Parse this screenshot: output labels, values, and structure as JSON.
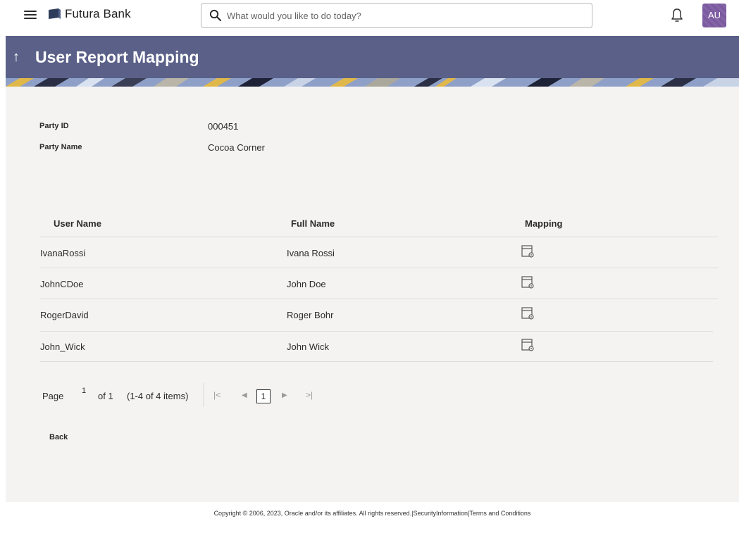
{
  "app": {
    "brand": "Futura Bank",
    "search_placeholder": "What would you like to do today?",
    "avatar_initials": "AU",
    "accent_color": "#5a6088"
  },
  "header": {
    "title": "User Report Mapping"
  },
  "party": {
    "id_label": "Party ID",
    "id_value": "000451",
    "name_label": "Party Name",
    "name_value": "Cocoa Corner"
  },
  "table": {
    "columns": [
      "User Name",
      "Full Name",
      "Mapping"
    ],
    "rows": [
      {
        "user_name": "IvanaRossi",
        "full_name": "Ivana Rossi",
        "mapping_icon": "report-settings-icon"
      },
      {
        "user_name": "JohnCDoe",
        "full_name": "John Doe",
        "mapping_icon": "report-settings-icon"
      },
      {
        "user_name": "RogerDavid",
        "full_name": "Roger Bohr",
        "mapping_icon": "report-settings-icon"
      },
      {
        "user_name": "John_Wick",
        "full_name": "John Wick",
        "mapping_icon": "report-settings-icon"
      }
    ]
  },
  "pagination": {
    "page_label": "Page",
    "current_page": "1",
    "of_text": "of 1",
    "items_text": "(1-4 of 4 items)",
    "first_icon": "first-page-icon",
    "prev_icon": "prev-page-icon",
    "next_icon": "next-page-icon",
    "last_icon": "last-page-icon"
  },
  "actions": {
    "back_label": "Back"
  },
  "footer": {
    "copyright": "Copyright © 2006, 2023, Oracle and/or its affiliates. All rights reserved.|SecurityInformation|Terms and Conditions"
  }
}
